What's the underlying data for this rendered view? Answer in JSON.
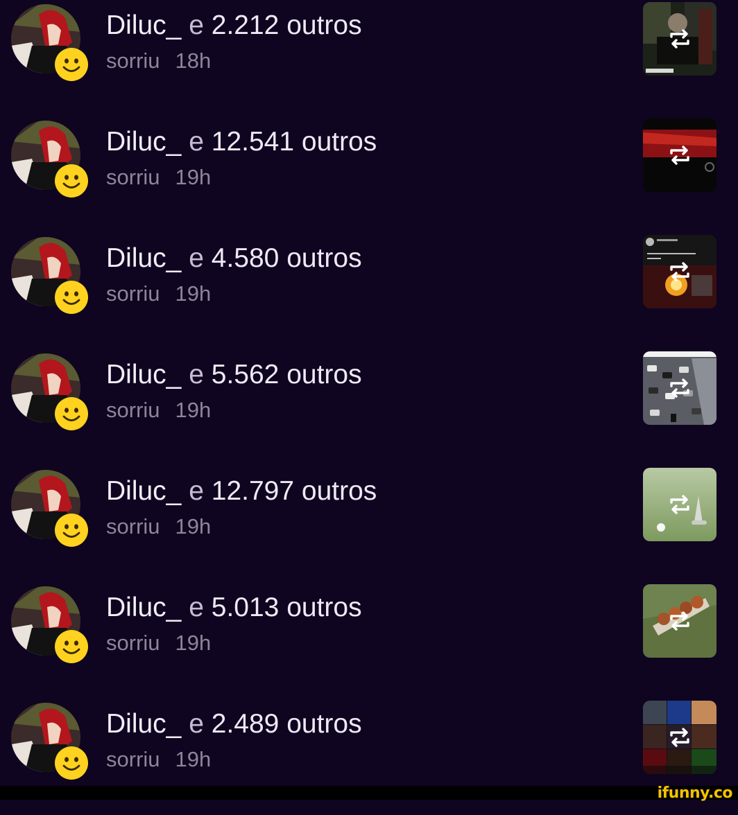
{
  "notifications": [
    {
      "user": "Diluc_",
      "conjunction": "e",
      "count_text": "2.212 outros",
      "action": "sorriu",
      "time": "18h",
      "thumb": "meeting-room"
    },
    {
      "user": "Diluc_",
      "conjunction": "e",
      "count_text": "12.541 outros",
      "action": "sorriu",
      "time": "19h",
      "thumb": "red-video"
    },
    {
      "user": "Diluc_",
      "conjunction": "e",
      "count_text": "4.580 outros",
      "action": "sorriu",
      "time": "19h",
      "thumb": "tweet-explosion"
    },
    {
      "user": "Diluc_",
      "conjunction": "e",
      "count_text": "5.562 outros",
      "action": "sorriu",
      "time": "19h",
      "thumb": "traffic-jam"
    },
    {
      "user": "Diluc_",
      "conjunction": "e",
      "count_text": "12.797 outros",
      "action": "sorriu",
      "time": "19h",
      "thumb": "golf-ball"
    },
    {
      "user": "Diluc_",
      "conjunction": "e",
      "count_text": "5.013 outros",
      "action": "sorriu",
      "time": "19h",
      "thumb": "food-on-grass"
    },
    {
      "user": "Diluc_",
      "conjunction": "e",
      "count_text": "2.489 outros",
      "action": "sorriu",
      "time": "19h",
      "thumb": "video-call-collage"
    }
  ],
  "icons": {
    "reaction": "smile-emoji-icon",
    "thumb_overlay": "repost-icon"
  },
  "watermark": "ifunny.co",
  "colors": {
    "background": "#0f0520",
    "primary_text": "#efe9f5",
    "secondary_text": "#8f8599",
    "emoji": "#ffd21f",
    "watermark": "#f2c200"
  }
}
